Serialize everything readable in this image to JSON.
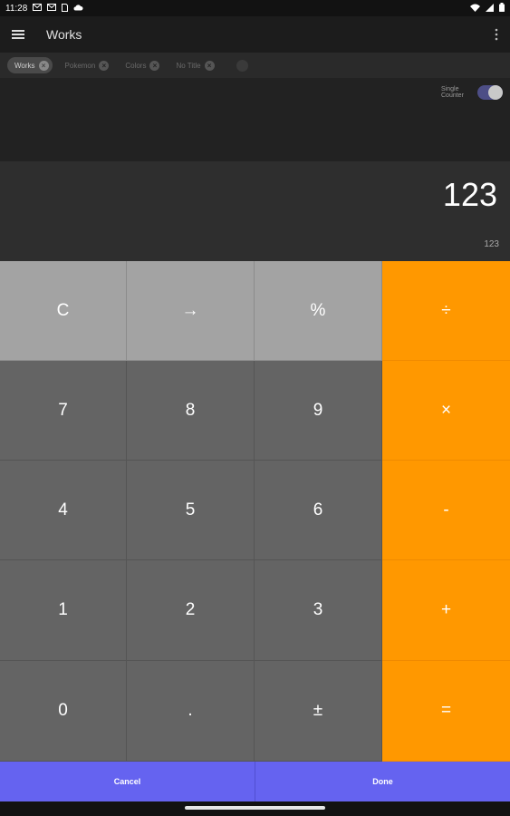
{
  "status_bar": {
    "time": "11:28",
    "icons_left": [
      "gmail-icon",
      "gmail-icon",
      "sim-icon",
      "cloud-icon"
    ],
    "icons_right": [
      "wifi-icon",
      "signal-icon",
      "battery-icon"
    ]
  },
  "app_bar": {
    "title": "Works"
  },
  "chips": [
    {
      "label": "Works",
      "active": true
    },
    {
      "label": "Pokemon",
      "active": false
    },
    {
      "label": "Colors",
      "active": false
    },
    {
      "label": "No Title",
      "active": false
    }
  ],
  "counter": {
    "single_counter_label_1": "Single",
    "single_counter_label_2": "Counter",
    "single_counter_on": true
  },
  "display": {
    "main_value": "123",
    "sub_value": "123"
  },
  "keys": {
    "row1": [
      "C",
      "→",
      "%",
      "÷"
    ],
    "row2": [
      "7",
      "8",
      "9",
      "×"
    ],
    "row3": [
      "4",
      "5",
      "6",
      "-"
    ],
    "row4": [
      "1",
      "2",
      "3",
      "+"
    ],
    "row5": [
      "0",
      ".",
      "±",
      "="
    ]
  },
  "buttons": {
    "cancel": "Cancel",
    "done": "Done"
  },
  "colors": {
    "operator": "#ff9800",
    "top_keys": "#a3a3a3",
    "number_keys": "#646464",
    "action_buttons": "#6563f0",
    "toggle": "#4d4e86"
  }
}
